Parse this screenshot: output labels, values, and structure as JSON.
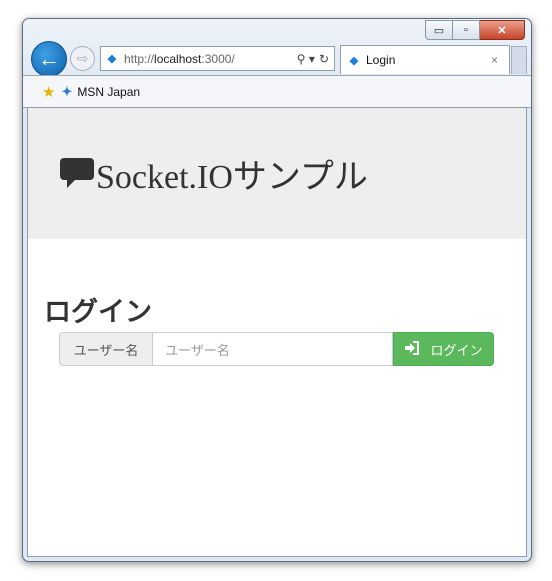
{
  "window": {
    "caption_buttons": {
      "minimize": "▭",
      "restore": "▫",
      "close": "✕"
    }
  },
  "nav": {
    "back_icon": "←",
    "forward_icon": "⇨"
  },
  "address_bar": {
    "url_prefix": "http://",
    "url_host": "localhost",
    "url_suffix": ":3000/",
    "search_icon": "⚲ ▾",
    "refresh_icon": "↻"
  },
  "tab": {
    "title": "Login",
    "close_icon": "×"
  },
  "favorites_bar": {
    "item_label": "MSN Japan"
  },
  "page": {
    "site_title": "Socket.IOサンプル",
    "login_heading": "ログイン",
    "username_addon": "ユーザー名",
    "username_placeholder": "ユーザー名",
    "login_button": "ログイン"
  },
  "colors": {
    "jumbotron_bg": "#eeeeee",
    "login_button": "#5cb85c",
    "ie_blue": "#0d5ea8"
  }
}
